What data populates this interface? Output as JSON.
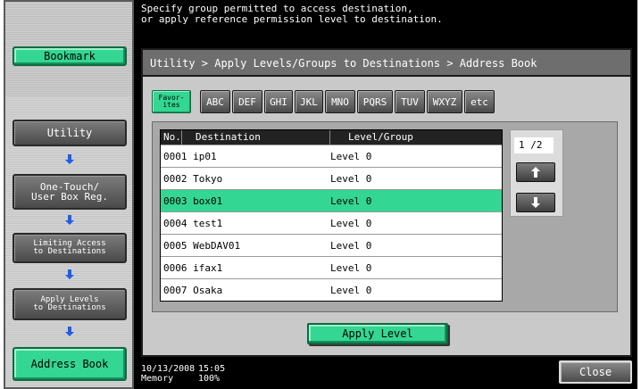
{
  "message": "Specify group permitted to access destination,\nor apply reference permission level to destination.",
  "left_panel": {
    "bookmark": "Bookmark",
    "steps": [
      {
        "label": "Utility"
      },
      {
        "label": "One-Touch/\nUser Box Reg."
      },
      {
        "label": "Limiting Access\nto Destinations"
      },
      {
        "label": "Apply Levels\nto Destinations"
      },
      {
        "label": "Address Book"
      }
    ]
  },
  "breadcrumb": "Utility > Apply Levels/Groups to Destinations > Address Book",
  "index_tabs": {
    "favorites": "Favor-\nites",
    "letters": [
      "ABC",
      "DEF",
      "GHI",
      "JKL",
      "MNO",
      "PQRS",
      "TUV",
      "WXYZ",
      "etc"
    ]
  },
  "table": {
    "headers": {
      "no": "No.",
      "destination": "Destination",
      "level": "Level/Group"
    },
    "rows": [
      {
        "dest": "0001 ip01",
        "level": "Level 0",
        "selected": false
      },
      {
        "dest": "0002 Tokyo",
        "level": "Level 0",
        "selected": false
      },
      {
        "dest": "0003 box01",
        "level": "Level 0",
        "selected": true
      },
      {
        "dest": "0004 test1",
        "level": "Level 0",
        "selected": false
      },
      {
        "dest": "0005 WebDAV01",
        "level": "Level 0",
        "selected": false
      },
      {
        "dest": "0006 ifax1",
        "level": "Level 0",
        "selected": false
      },
      {
        "dest": "0007 Osaka",
        "level": "Level 0",
        "selected": false
      }
    ]
  },
  "pager": {
    "page": "1 /2"
  },
  "apply_button": "Apply Level",
  "status": {
    "date": "10/13/2008",
    "time": "15:05",
    "memory_label": "Memory",
    "memory_value": "100%"
  },
  "close_button": "Close",
  "colors": {
    "accent_green": "#33d692",
    "frame_gray": "#c9c9c9",
    "dark": "#000000"
  },
  "icons": {
    "step_arrow": "arrow-down-icon",
    "scroll_up": "arrow-up-icon",
    "scroll_down": "arrow-down-icon"
  }
}
